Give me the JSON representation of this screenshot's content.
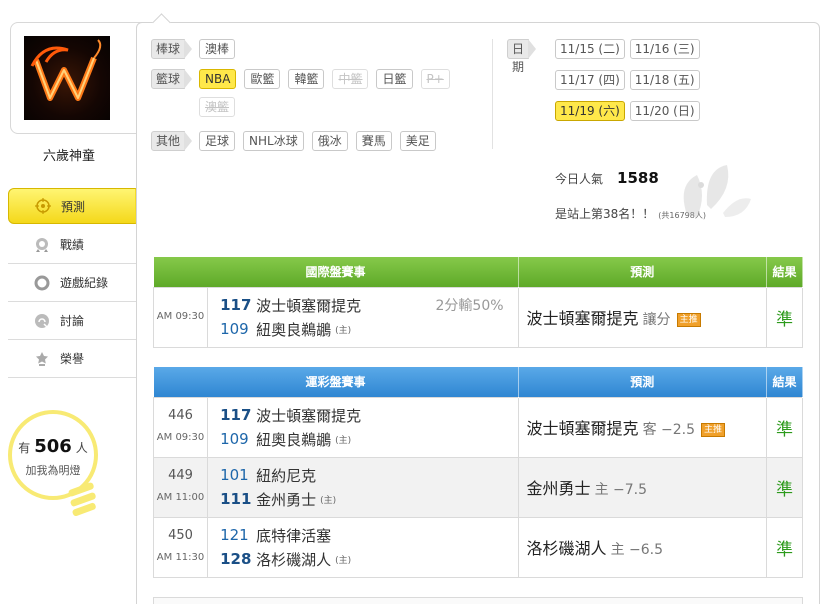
{
  "profile": {
    "name": "六歲神童"
  },
  "nav": {
    "items": [
      {
        "label": "預測",
        "icon": "target-icon",
        "active": true
      },
      {
        "label": "戰績",
        "icon": "record-icon"
      },
      {
        "label": "遊戲紀錄",
        "icon": "ring-icon"
      },
      {
        "label": "討論",
        "icon": "chat-icon"
      },
      {
        "label": "榮譽",
        "icon": "medal-icon"
      }
    ]
  },
  "bulb": {
    "prefix": "有",
    "count": "506",
    "suffix": "人",
    "sub": "加我為明燈"
  },
  "categories": {
    "baseball": {
      "label": "棒球",
      "items": [
        "澳棒"
      ]
    },
    "basketball": {
      "label": "籃球",
      "items": [
        "NBA",
        "歐籃",
        "韓籃",
        "中籃",
        "日籃",
        "P+",
        "澳籃"
      ]
    },
    "other": {
      "label": "其他",
      "items": [
        "足球",
        "NHL冰球",
        "俄冰",
        "賽馬",
        "美足"
      ]
    }
  },
  "dates": {
    "label": "日期",
    "items": [
      "11/15 (二)",
      "11/16 (三)",
      "11/17 (四)",
      "11/18 (五)",
      "11/19 (六)",
      "11/20 (日)"
    ],
    "selected": "11/19 (六)"
  },
  "popularity": {
    "label": "今日人氣",
    "value": "1588",
    "rank_text": "是站上第38名！！",
    "rank_total": "(共16798人)"
  },
  "intl_table": {
    "headers": [
      "國際盤賽事",
      "預測",
      "結果"
    ],
    "rows": [
      {
        "time": "AM 09:30",
        "away_score": "117",
        "away": "波士頓塞爾提克",
        "home_score": "109",
        "home": "紐奧良鵜鶘",
        "home_mark": "(主)",
        "spread": "2分輸50%",
        "pick": "波士頓塞爾提克",
        "pick_sub": "讓分",
        "tag": "主推",
        "result": "準"
      }
    ]
  },
  "lottery_table": {
    "headers": [
      "運彩盤賽事",
      "預測",
      "結果"
    ],
    "rows": [
      {
        "no": "446",
        "time": "AM 09:30",
        "away_score": "117",
        "away": "波士頓塞爾提克",
        "home_score": "109",
        "home": "紐奧良鵜鶘",
        "home_mark": "(主)",
        "pick": "波士頓塞爾提克",
        "pick_sub": "客 −2.5",
        "tag": "主推",
        "result": "準"
      },
      {
        "no": "449",
        "time": "AM 11:00",
        "away_score": "101",
        "away": "紐約尼克",
        "home_score": "111",
        "home": "金州勇士",
        "home_mark": "(主)",
        "pick": "金州勇士",
        "pick_sub": "主 −7.5",
        "tag": "",
        "result": "準"
      },
      {
        "no": "450",
        "time": "AM 11:30",
        "away_score": "121",
        "away": "底特律活塞",
        "home_score": "128",
        "home": "洛杉磯湖人",
        "home_mark": "(主)",
        "pick": "洛杉磯湖人",
        "pick_sub": "主 −6.5",
        "tag": "",
        "result": "準"
      }
    ]
  },
  "colors": {
    "accent_yellow": "#ffe84a",
    "green_header": "#5ea928",
    "blue_header": "#2f86d2",
    "result_green": "#2d9a1c"
  }
}
